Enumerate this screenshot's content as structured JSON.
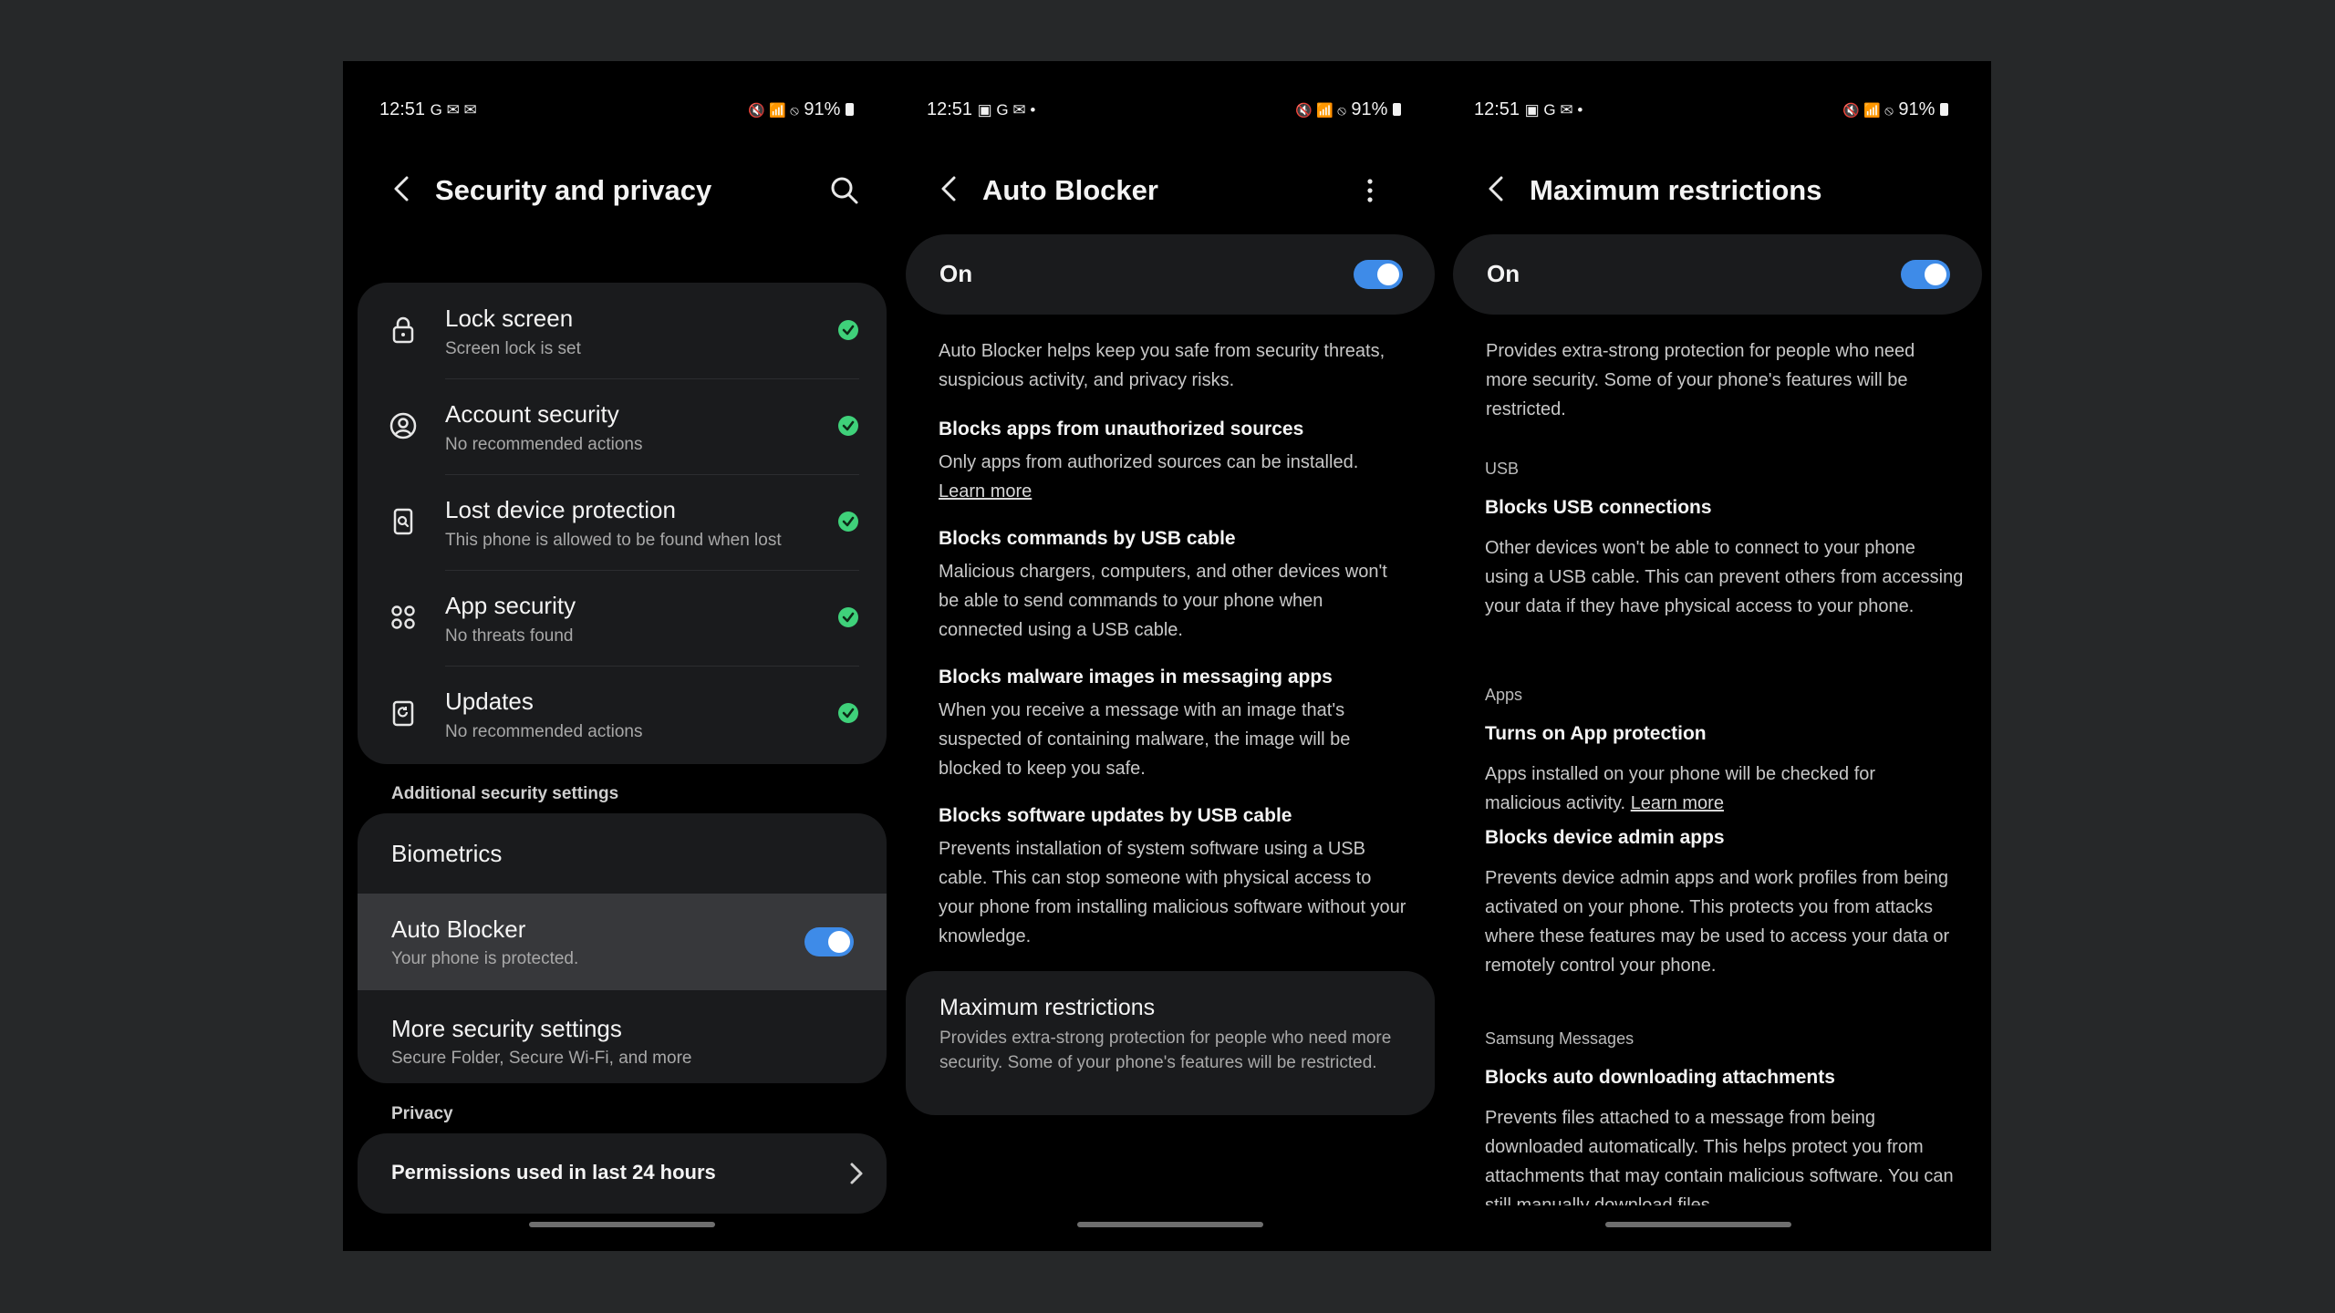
{
  "colors": {
    "accent": "#3e8be8",
    "check": "#3fd17a",
    "card": "#1a1b1d",
    "background": "#000000"
  },
  "panel1": {
    "status": {
      "time": "12:51",
      "left_icons": "G ✉ ✉",
      "right_icons": "🔇 📶 ⦸",
      "battery": "91%"
    },
    "title": "Security and privacy",
    "items": [
      {
        "title": "Lock screen",
        "subtitle": "Screen lock is set",
        "icon": "lock-icon"
      },
      {
        "title": "Account security",
        "subtitle": "No recommended actions",
        "icon": "account-icon"
      },
      {
        "title": "Lost device protection",
        "subtitle": "This phone is allowed to be found when lost",
        "icon": "find-device-icon"
      },
      {
        "title": "App security",
        "subtitle": "No threats found",
        "icon": "app-grid-icon"
      },
      {
        "title": "Updates",
        "subtitle": "No recommended actions",
        "icon": "update-icon"
      }
    ],
    "additional_label": "Additional security settings",
    "biometrics": "Biometrics",
    "auto_blocker": {
      "title": "Auto Blocker",
      "subtitle": "Your phone is protected.",
      "enabled": true
    },
    "more_security": {
      "title": "More security settings",
      "subtitle": "Secure Folder, Secure Wi-Fi, and more"
    },
    "privacy_label": "Privacy",
    "permissions": "Permissions used in last 24 hours"
  },
  "panel2": {
    "status": {
      "time": "12:51",
      "left_icons": "▣ G ✉ •",
      "right_icons": "🔇 📶 ⦸",
      "battery": "91%"
    },
    "title": "Auto Blocker",
    "toggle_label": "On",
    "intro": "Auto Blocker helps keep you safe from security threats, suspicious activity, and privacy risks.",
    "sections": [
      {
        "heading": "Blocks apps from unauthorized sources",
        "body": "Only apps from authorized sources can be installed.",
        "link": "Learn more"
      },
      {
        "heading": "Blocks commands by USB cable",
        "body": "Malicious chargers, computers, and other devices won't be able to send commands to your phone when connected using a USB cable."
      },
      {
        "heading": "Blocks malware images in messaging apps",
        "body": "When you receive a message with an image that's suspected of containing malware, the image will be blocked to keep you safe."
      },
      {
        "heading": "Blocks software updates by USB cable",
        "body": "Prevents installation of system software using a USB cable. This can stop someone with physical access to your phone from installing malicious software without your knowledge."
      }
    ],
    "max_card": {
      "title": "Maximum restrictions",
      "body": "Provides extra-strong protection for people who need more security. Some of your phone's features will be restricted."
    }
  },
  "panel3": {
    "status": {
      "time": "12:51",
      "left_icons": "▣ G ✉ •",
      "right_icons": "🔇 📶 ⦸",
      "battery": "91%"
    },
    "title": "Maximum restrictions",
    "toggle_label": "On",
    "intro": "Provides extra-strong protection for people who need more security. Some of your phone's features will be restricted.",
    "usb_label": "USB",
    "usb_heading": "Blocks USB connections",
    "usb_body": "Other devices won't be able to connect to your phone using a USB cable. This can prevent others from accessing your data if they have physical access to your phone.",
    "apps_label": "Apps",
    "apps_heading": "Turns on App protection",
    "apps_body": "Apps installed on your phone will be checked for malicious activity.",
    "apps_link": "Learn more",
    "admin_heading": "Blocks device admin apps",
    "admin_body": "Prevents device admin apps and work profiles from being activated on your phone. This protects you from attacks where these features may be used to access your data or remotely control your phone.",
    "messages_label": "Samsung Messages",
    "messages_heading": "Blocks auto downloading attachments",
    "messages_body": "Prevents files attached to a message from being downloaded automatically. This helps protect you from attachments that may contain malicious software. You can still manually download files"
  }
}
